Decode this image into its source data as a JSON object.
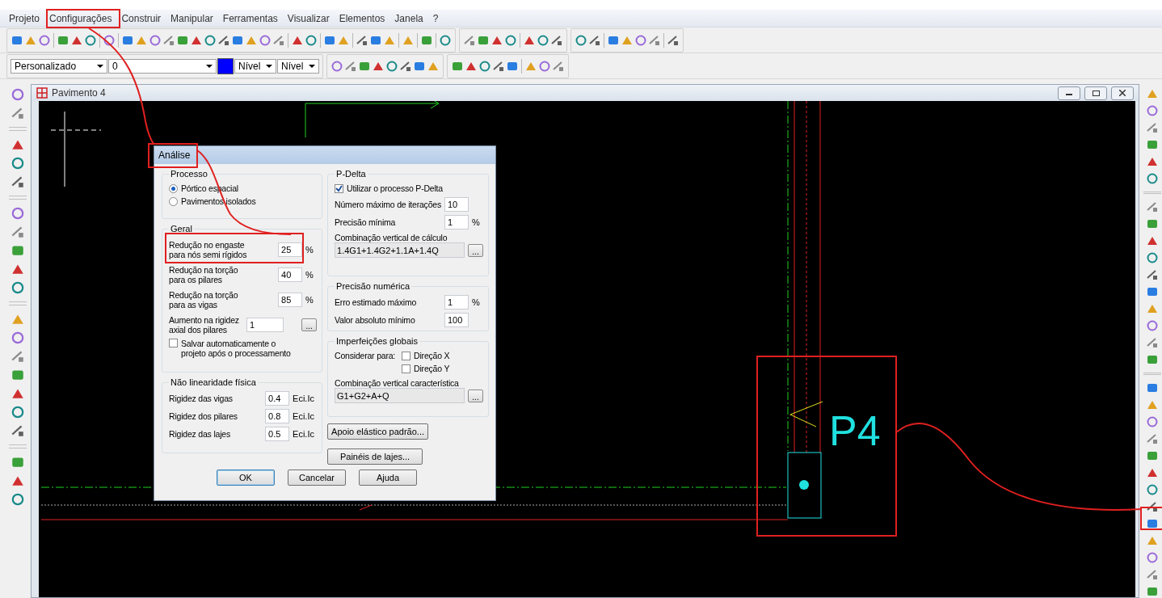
{
  "menu": [
    {
      "label": "Projeto"
    },
    {
      "label": "Configurações"
    },
    {
      "label": "Construir"
    },
    {
      "label": "Manipular"
    },
    {
      "label": "Ferramentas"
    },
    {
      "label": "Visualizar"
    },
    {
      "label": "Elementos"
    },
    {
      "label": "Janela"
    },
    {
      "label": "?"
    }
  ],
  "format_bar": {
    "style_combo": "Personalizado",
    "layer_combo": "0",
    "level_combos": [
      "Nível",
      "Nível"
    ]
  },
  "window": {
    "title": "Pavimento 4"
  },
  "canvas": {
    "pillar_label": "P4"
  },
  "dialog": {
    "title": "Análise",
    "processo": {
      "title": "Processo",
      "options": [
        {
          "label": "Pórtico espacial",
          "selected": true
        },
        {
          "label": "Pavimentos isolados",
          "selected": false
        }
      ]
    },
    "geral": {
      "title": "Geral",
      "fields": [
        {
          "label": "Redução no engaste\npara nós semi rígidos",
          "value": "25",
          "unit": "%"
        },
        {
          "label": "Redução na torção\npara os pilares",
          "value": "40",
          "unit": "%"
        },
        {
          "label": "Redução na torção\npara as vigas",
          "value": "85",
          "unit": "%"
        },
        {
          "label": "Aumento na rigidez\naxial dos pilares",
          "value": "1",
          "button": "..."
        }
      ],
      "checkbox": {
        "label": "Salvar automaticamente o\nprojeto após o processamento",
        "checked": false
      }
    },
    "nao_linearidade": {
      "title": "Não linearidade física",
      "rows": [
        {
          "label": "Rigidez das vigas",
          "value": "0.4",
          "unit": "Eci.Ic"
        },
        {
          "label": "Rigidez dos pilares",
          "value": "0.8",
          "unit": "Eci.Ic"
        },
        {
          "label": "Rigidez das lajes",
          "value": "0.5",
          "unit": "Eci.Ic"
        }
      ]
    },
    "p_delta": {
      "title": "P-Delta",
      "checkbox": {
        "label": "Utilizar o processo P-Delta",
        "checked": true
      },
      "fields": [
        {
          "label": "Número máximo de iterações",
          "value": "10"
        },
        {
          "label": "Precisão mínima",
          "value": "1",
          "unit": "%"
        }
      ],
      "combo_label": "Combinação vertical de cálculo",
      "combo_value": "1.4G1+1.4G2+1.1A+1.4Q",
      "combo_button": "..."
    },
    "precisao": {
      "title": "Precisão numérica",
      "fields": [
        {
          "label": "Erro estimado máximo",
          "value": "1",
          "unit": "%"
        },
        {
          "label": "Valor absoluto mínimo",
          "value": "100"
        }
      ]
    },
    "imperfeicoes": {
      "title": "Imperfeições globais",
      "consider_label": "Considerar para:",
      "checks": [
        {
          "label": "Direção X",
          "checked": false
        },
        {
          "label": "Direção Y",
          "checked": false
        }
      ],
      "combo_label": "Combinação vertical característica",
      "combo_value": "G1+G2+A+Q",
      "combo_button": "..."
    },
    "side_buttons": [
      "Apoio elástico padrão...",
      "Painéis de lajes..."
    ],
    "buttons": [
      {
        "label": "OK",
        "default": true
      },
      {
        "label": "Cancelar",
        "default": false
      },
      {
        "label": "Ajuda",
        "default": false
      }
    ]
  }
}
